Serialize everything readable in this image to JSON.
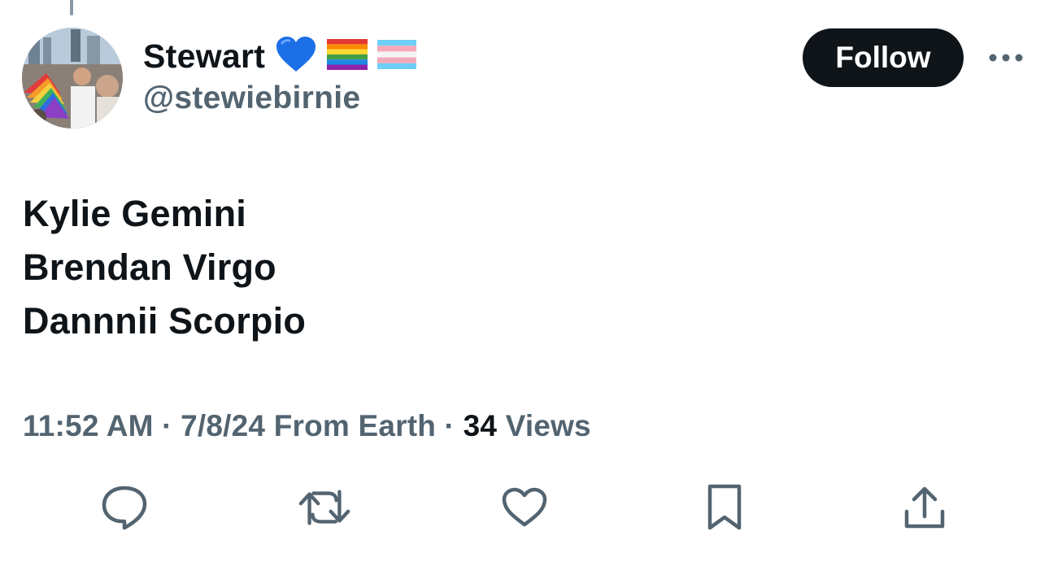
{
  "author": {
    "display_name": "Stewart",
    "badges": [
      "blue-heart-emoji",
      "rainbow-flag-emoji",
      "transgender-flag-emoji"
    ],
    "handle": "@stewiebirnie"
  },
  "follow_button": {
    "label": "Follow"
  },
  "tweet": {
    "lines": [
      "Kylie Gemini",
      "Brendan Virgo",
      "Dannnii Scorpio"
    ]
  },
  "meta": {
    "time": "11:52 AM",
    "separator": "·",
    "date": "7/8/24",
    "source": "From Earth",
    "views_count": "34",
    "views_label": "Views"
  },
  "actions": [
    "reply-icon",
    "retweet-icon",
    "like-icon",
    "bookmark-icon",
    "share-icon"
  ],
  "colors": {
    "text_primary": "#0f1419",
    "text_secondary": "#536471",
    "follow_bg": "#0f1419",
    "icon": "#536471"
  }
}
